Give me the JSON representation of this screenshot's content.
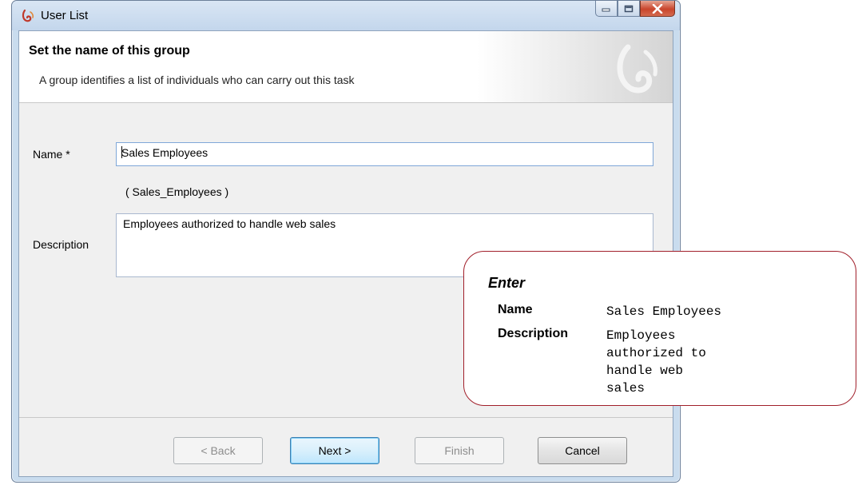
{
  "window": {
    "title": "User List",
    "icon": "app-logo-icon"
  },
  "caption_buttons": [
    "minimize-icon",
    "maximize-icon",
    "close-icon"
  ],
  "header": {
    "title": "Set the name of this group",
    "subtitle": "A group identifies a list of individuals who can carry out this task"
  },
  "form": {
    "name_label": "Name *",
    "name_value": "Sales Employees",
    "identifier": "( Sales_Employees )",
    "description_label": "Description",
    "description_value": "Employees authorized to handle web sales"
  },
  "buttons": {
    "back": "< Back",
    "next": "Next >",
    "finish": "Finish",
    "cancel": "Cancel"
  },
  "callout": {
    "heading": "Enter",
    "rows": [
      {
        "label": "Name",
        "value": "Sales Employees"
      },
      {
        "label": "Description",
        "value": "Employees authorized to handle web sales"
      }
    ],
    "accent_color": "#a11f2a"
  }
}
